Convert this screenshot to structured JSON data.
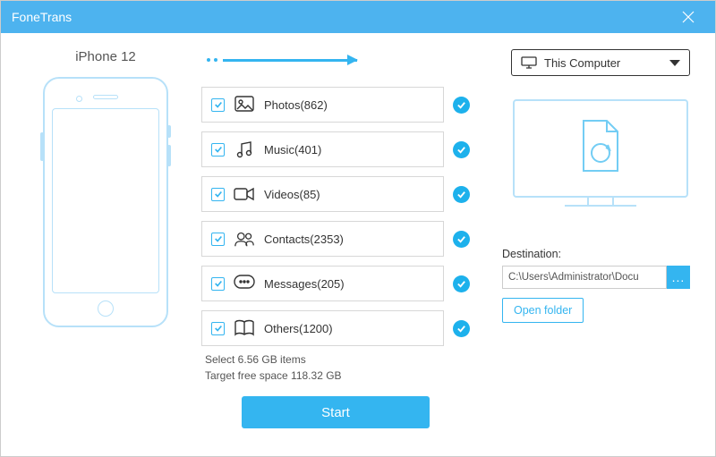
{
  "app_title": "FoneTrans",
  "device_name": "iPhone 12",
  "categories": [
    {
      "label": "Photos(862)"
    },
    {
      "label": "Music(401)"
    },
    {
      "label": "Videos(85)"
    },
    {
      "label": "Contacts(2353)"
    },
    {
      "label": "Messages(205)"
    },
    {
      "label": "Others(1200)"
    }
  ],
  "summary": {
    "selected": "Select 6.56 GB items",
    "free_space": "Target free space 118.32 GB"
  },
  "start_label": "Start",
  "destination": {
    "selected_target": "This Computer",
    "label": "Destination:",
    "path": "C:\\Users\\Administrator\\Docu",
    "browse": "...",
    "open_folder": "Open folder"
  }
}
